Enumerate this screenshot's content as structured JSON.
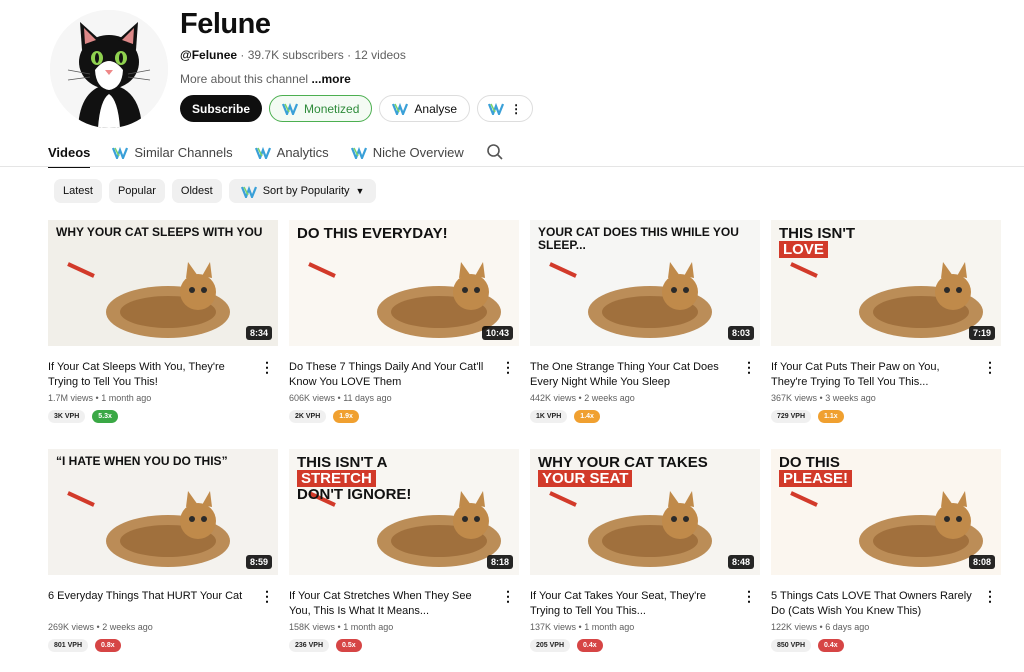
{
  "channel": {
    "name": "Felune",
    "handle": "@Felunee",
    "subscribers": "39.7K subscribers",
    "videos_count": "12 videos",
    "about": "More about this channel",
    "more": "...more"
  },
  "buttons": {
    "subscribe": "Subscribe",
    "monetized": "Monetized",
    "analyse": "Analyse",
    "more": "⋮"
  },
  "tabs": [
    {
      "label": "Videos"
    },
    {
      "label": "Similar Channels"
    },
    {
      "label": "Analytics"
    },
    {
      "label": "Niche Overview"
    }
  ],
  "filters": {
    "latest": "Latest",
    "popular": "Popular",
    "oldest": "Oldest",
    "sort": "Sort by Popularity"
  },
  "colors": {
    "green": "#3aa845",
    "orange": "#f0a030",
    "red": "#d64545"
  },
  "videos": [
    {
      "title": "If Your Cat Sleeps With You, They're Trying to Tell You This!",
      "views": "1.7M views",
      "age": "1 month ago",
      "duration": "8:34",
      "vph": "3K VPH",
      "mult": "5.3x",
      "mult_color": "green",
      "thumb_text": "WHY YOUR CAT SLEEPS WITH YOU"
    },
    {
      "title": "Do These 7 Things Daily And Your Cat'll Know You LOVE Them",
      "views": "606K views",
      "age": "11 days ago",
      "duration": "10:43",
      "vph": "2K VPH",
      "mult": "1.9x",
      "mult_color": "orange",
      "thumb_text": "DO THIS EVERYDAY!"
    },
    {
      "title": "The One Strange Thing Your Cat Does Every Night While You Sleep",
      "views": "442K views",
      "age": "2 weeks ago",
      "duration": "8:03",
      "vph": "1K VPH",
      "mult": "1.4x",
      "mult_color": "orange",
      "thumb_text": "YOUR CAT DOES THIS WHILE YOU SLEEP..."
    },
    {
      "title": "If Your Cat Puts Their Paw on You, They're Trying To Tell You This...",
      "views": "367K views",
      "age": "3 weeks ago",
      "duration": "7:19",
      "vph": "729 VPH",
      "mult": "1.1x",
      "mult_color": "orange",
      "thumb_text": "THIS ISN'T",
      "thumb_text2": "LOVE"
    },
    {
      "title": "6 Everyday Things That HURT Your Cat",
      "views": "269K views",
      "age": "2 weeks ago",
      "duration": "8:59",
      "vph": "801 VPH",
      "mult": "0.8x",
      "mult_color": "red",
      "thumb_text": "“I HATE WHEN YOU DO THIS”"
    },
    {
      "title": "If Your Cat Stretches When They See You, This Is What It Means...",
      "views": "158K views",
      "age": "1 month ago",
      "duration": "8:18",
      "vph": "236 VPH",
      "mult": "0.5x",
      "mult_color": "red",
      "thumb_text": "THIS ISN'T A",
      "thumb_text2": "STRETCH",
      "thumb_text3": "DON'T IGNORE!"
    },
    {
      "title": "If Your Cat Takes Your Seat, They're Trying to Tell You This...",
      "views": "137K views",
      "age": "1 month ago",
      "duration": "8:48",
      "vph": "205 VPH",
      "mult": "0.4x",
      "mult_color": "red",
      "thumb_text": "WHY YOUR CAT TAKES",
      "thumb_text2": "YOUR SEAT"
    },
    {
      "title": "5 Things Cats LOVE That Owners Rarely Do (Cats Wish You Knew This)",
      "views": "122K views",
      "age": "6 days ago",
      "duration": "8:08",
      "vph": "850 VPH",
      "mult": "0.4x",
      "mult_color": "red",
      "thumb_text": "DO THIS",
      "thumb_text2": "PLEASE!"
    }
  ]
}
